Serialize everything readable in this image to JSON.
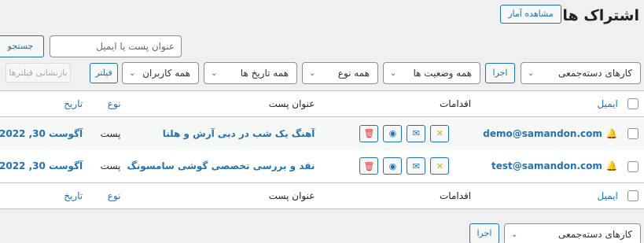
{
  "page": {
    "title": "اشتراک ها",
    "stats_button": "مشاهده آمار"
  },
  "search": {
    "placeholder": "عنوان پست یا ایمیل",
    "button": "جستجو"
  },
  "filters": {
    "bulk_actions": "کارهای دسته‌جمعی",
    "apply": "اجرا",
    "all_statuses": "همه وضعیت ها",
    "all_types": "همه نوع",
    "all_dates": "همه تاریخ ها",
    "all_users": "همه کاربران",
    "filter": "فیلتر",
    "reset": "بازنشانی فیلترها"
  },
  "table": {
    "headers": {
      "email": "ایمیل",
      "actions": "اقدامات",
      "post_title": "عنوان پست",
      "type": "نوع",
      "date": "تاریخ"
    },
    "rows": [
      {
        "email": "demo@samandon.com",
        "post_title": "آهنگ یک شب در دبی آرش و هلنا",
        "type": "پست",
        "date": "آگوست 30, 2022"
      },
      {
        "email": "test@samandon.com",
        "post_title": "نقد و بررسی تخصصی گوشی سامسونگ",
        "type": "پست",
        "date": "آگوست 30, 2022"
      }
    ]
  },
  "bottom": {
    "bulk_actions": "کارهای دسته‌جمعی",
    "apply": "اجرا"
  },
  "icons": {
    "bell": "bell-icon",
    "mute": "bell-off-icon",
    "mail": "envelope-icon",
    "view": "eye-icon",
    "delete": "trash-icon",
    "chevron": "chevron-down-icon"
  },
  "colors": {
    "accent": "#2271b1",
    "delete": "#d63638",
    "notify": "#00a32a",
    "mute": "#dba617"
  }
}
